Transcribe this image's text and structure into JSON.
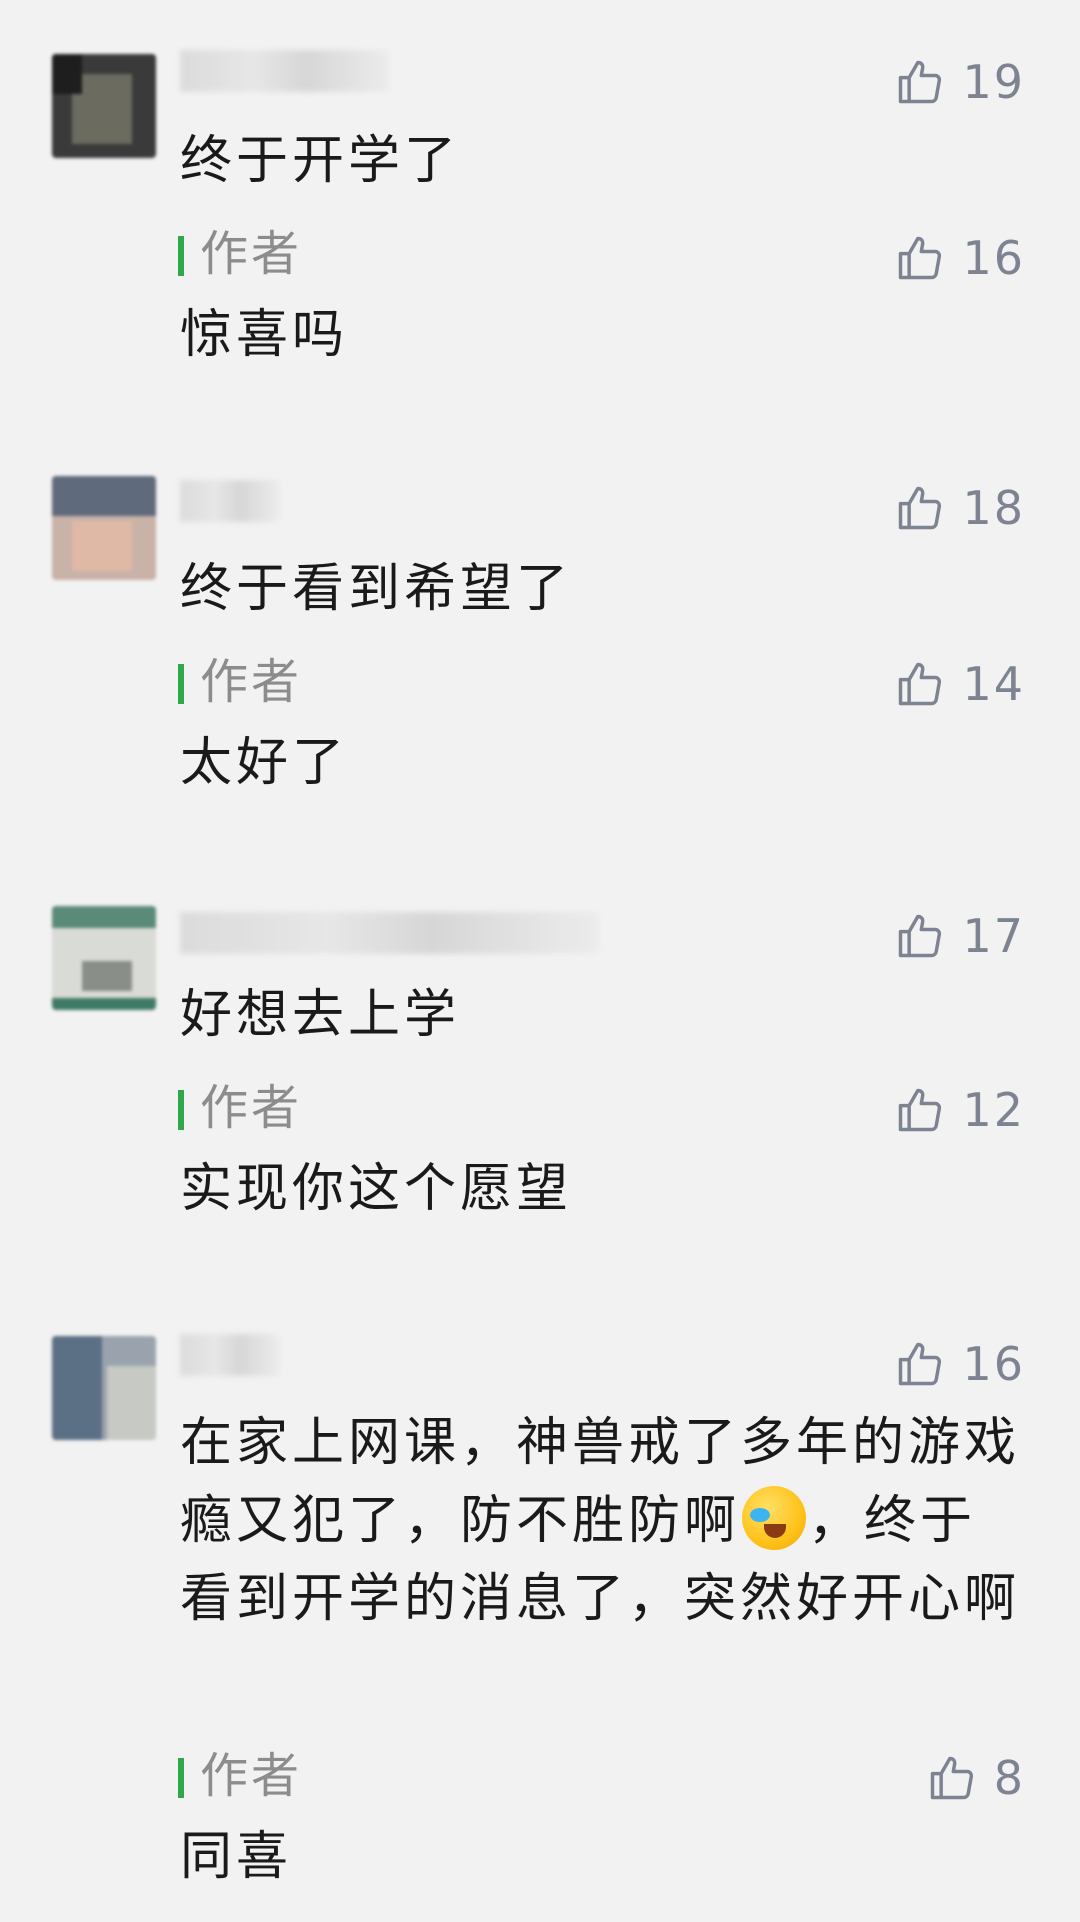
{
  "comments": [
    {
      "text": "终于开学了",
      "likes": "19",
      "reply": {
        "label": "作者",
        "text": "惊喜吗",
        "likes": "16"
      }
    },
    {
      "text": "终于看到希望了",
      "likes": "18",
      "reply": {
        "label": "作者",
        "text": "太好了",
        "likes": "14"
      }
    },
    {
      "text": "好想去上学",
      "likes": "17",
      "reply": {
        "label": "作者",
        "text": "实现你这个愿望",
        "likes": "12"
      }
    },
    {
      "text_parts": [
        "在家上网课，神兽戒了多年的游戏瘾又犯了，防不胜防啊",
        "，终于看到开学的消息了，突然好开心啊"
      ],
      "likes": "16",
      "reply": {
        "label": "作者",
        "text": "同喜",
        "likes": "8"
      }
    }
  ],
  "colors": {
    "author_bar": "#2ea84a",
    "like_count": "#7d8391",
    "background": "#f2f2f2"
  },
  "icons": {
    "like": "thumbs-up-icon",
    "emoji": "laughing-crying-emoji"
  }
}
